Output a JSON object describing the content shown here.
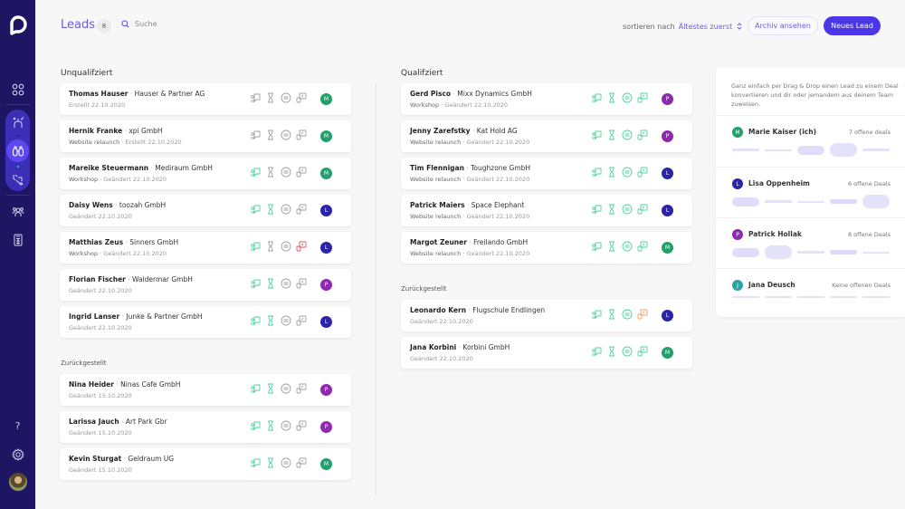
{
  "header": {
    "title": "Leads",
    "count": "8",
    "search_placeholder": "Suche",
    "sort_label": "sortieren nach",
    "sort_value": "Ältestes zuerst",
    "archive_button": "Archiv ansehen",
    "new_button": "Neues Lead"
  },
  "sidebar": {
    "items": [
      {
        "name": "dashboard",
        "icon": "grid-icon"
      },
      {
        "name": "workflow",
        "icon": "merge-arrows-icon"
      },
      {
        "name": "leads",
        "icon": "binoculars-icon",
        "active": true
      },
      {
        "name": "deals",
        "icon": "handshake-icon"
      },
      {
        "name": "team",
        "icon": "team-icon"
      },
      {
        "name": "reports",
        "icon": "calculator-icon"
      },
      {
        "name": "help",
        "icon": "question-icon"
      },
      {
        "name": "settings",
        "icon": "gear-icon"
      }
    ]
  },
  "colors": {
    "green": "#22a06b",
    "blue": "#2b24a8",
    "purple": "#8e2aad",
    "teal": "#2aa3a3",
    "accent": "#4a36e6",
    "icon_active": "#4fd39a",
    "icon_inactive": "#a0a0a6",
    "icon_red": "#e05566",
    "icon_orange": "#f0a060"
  },
  "unqualified": {
    "title": "Unqualifziert",
    "cards": [
      {
        "name": "Thomas Hauser",
        "company": "Hauser & Partner AG",
        "tag": "",
        "date": "Erstellt 22.10.2020",
        "avatar": "M",
        "avatar_color": "green",
        "status": [
          "off",
          "off",
          "off",
          "off"
        ]
      },
      {
        "name": "Hernik Franke",
        "company": "xpi GmbH",
        "tag": "Website relaunch",
        "date": "Erstellt 22.10.2020",
        "avatar": "M",
        "avatar_color": "green",
        "status": [
          "off",
          "off",
          "off",
          "off"
        ]
      },
      {
        "name": "Mareike Steuermann",
        "company": "Mediraum GmbH",
        "tag": "Workshop",
        "date": "Geändert 22.10.2020",
        "avatar": "M",
        "avatar_color": "green",
        "status": [
          "on",
          "off",
          "off",
          "off"
        ]
      },
      {
        "name": "Daisy Wens",
        "company": "toozah GmbH",
        "tag": "",
        "date": "Geändert 22.10.2020",
        "avatar": "L",
        "avatar_color": "blue",
        "status": [
          "on",
          "on",
          "off",
          "off"
        ]
      },
      {
        "name": "Matthias Zeus",
        "company": "Sinners GmbH",
        "tag": "Workshop",
        "date": "Geändert 22.10.2020",
        "avatar": "L",
        "avatar_color": "blue",
        "status": [
          "on",
          "off",
          "off",
          "red"
        ]
      },
      {
        "name": "Florian Fischer",
        "company": "Waldermar GmbH",
        "tag": "",
        "date": "Geändert 22.10.2020",
        "avatar": "P",
        "avatar_color": "purple",
        "status": [
          "on",
          "on",
          "off",
          "off"
        ]
      },
      {
        "name": "Ingrid Lanser",
        "company": "Junke & Partner GmbH",
        "tag": "",
        "date": "Geändert 22.10.2020",
        "avatar": "L",
        "avatar_color": "blue",
        "status": [
          "on",
          "on",
          "off",
          "off"
        ]
      }
    ],
    "deferred_title": "Zurückgestellt",
    "deferred": [
      {
        "name": "Nina Heider",
        "company": "Ninas Cafe GmbH",
        "tag": "",
        "date": "Geändert 15.10.2020",
        "avatar": "P",
        "avatar_color": "purple",
        "status": [
          "on",
          "on",
          "off",
          "off"
        ]
      },
      {
        "name": "Larissa Jauch",
        "company": "Art Park Gbr",
        "tag": "",
        "date": "Geändert 15.10.2020",
        "avatar": "P",
        "avatar_color": "purple",
        "status": [
          "on",
          "on",
          "off",
          "off"
        ]
      },
      {
        "name": "Kevin Sturgat",
        "company": "Geldraum UG",
        "tag": "",
        "date": "Geändert 15.10.2020",
        "avatar": "M",
        "avatar_color": "green",
        "status": [
          "on",
          "on",
          "off",
          "off"
        ]
      }
    ]
  },
  "qualified": {
    "title": "Qualifziert",
    "cards": [
      {
        "name": "Gerd Pisco",
        "company": "Mixx Dynamics GmbH",
        "tag": "Workshop",
        "date": "Geändert 22.10.2020",
        "avatar": "P",
        "avatar_color": "purple",
        "status": [
          "on",
          "on",
          "on",
          "on"
        ]
      },
      {
        "name": "Jenny Zarefstky",
        "company": "Kat Hold AG",
        "tag": "Website relaunch",
        "date": "Geändert 22.10.2020",
        "avatar": "P",
        "avatar_color": "purple",
        "status": [
          "on",
          "on",
          "on",
          "on"
        ]
      },
      {
        "name": "Tim Flennigan",
        "company": "Toughzone GmbH",
        "tag": "Website relaunch",
        "date": "Geändert 22.10.2020",
        "avatar": "L",
        "avatar_color": "blue",
        "status": [
          "on",
          "on",
          "on",
          "on"
        ]
      },
      {
        "name": "Patrick Maiers",
        "company": "Space Elephant",
        "tag": "Website relaunch",
        "date": "Geändert 22.10.2020",
        "avatar": "L",
        "avatar_color": "blue",
        "status": [
          "on",
          "on",
          "on",
          "on"
        ]
      },
      {
        "name": "Margot Zeuner",
        "company": "Freilando GmbH",
        "tag": "Website relaunch",
        "date": "Geändert 22.10.2020",
        "avatar": "M",
        "avatar_color": "green",
        "status": [
          "on",
          "on",
          "on",
          "on"
        ]
      }
    ],
    "deferred_title": "Zurückgestellt",
    "deferred": [
      {
        "name": "Leonardo Kern",
        "company": "Flugschule Endlingen",
        "tag": "",
        "date": "Geändert 22.10.2020",
        "avatar": "L",
        "avatar_color": "blue",
        "status": [
          "on",
          "on",
          "on",
          "orange"
        ]
      },
      {
        "name": "Jana Korbini",
        "company": "Korbini GmbH",
        "tag": "",
        "date": "Geändert 22.10.2020",
        "avatar": "M",
        "avatar_color": "green",
        "status": [
          "on",
          "on",
          "on",
          "on"
        ]
      }
    ]
  },
  "team": {
    "intro": "Ganz einfach per Drag & Drop einen Lead zu einem Deal konvertieren und dir oder jemandem aus deinem Team zuweisen.",
    "members": [
      {
        "name": "Marie Kaiser (ich)",
        "initial": "M",
        "color": "green",
        "deals": "7 offene deals",
        "slots": [
          "line",
          "thin",
          "pill",
          "big",
          "line"
        ]
      },
      {
        "name": "Lisa Oppenheim",
        "initial": "L",
        "color": "blue",
        "deals": "6 offene Deals",
        "slots": [
          "pill",
          "line",
          "thin",
          "mid",
          "big"
        ]
      },
      {
        "name": "Patrick Hollak",
        "initial": "P",
        "color": "purple",
        "deals": "8 offene Deals",
        "slots": [
          "pill",
          "big",
          "line",
          "mid",
          "thin"
        ]
      },
      {
        "name": "Jana Deusch",
        "initial": "J",
        "color": "teal",
        "deals": "Keine offenen Deals",
        "slots": [
          "thin",
          "thin",
          "thin",
          "thin",
          "thin"
        ]
      }
    ]
  }
}
